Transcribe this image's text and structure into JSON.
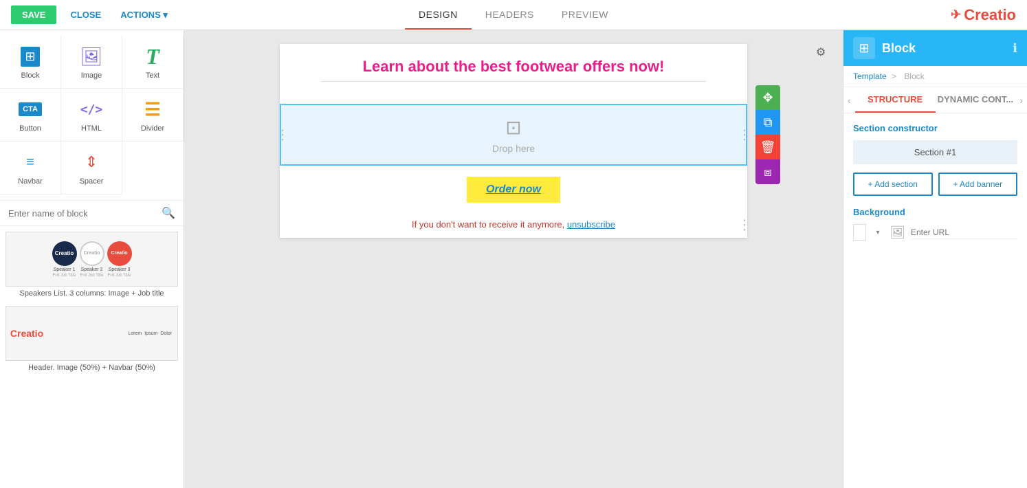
{
  "topbar": {
    "save_label": "SAVE",
    "close_label": "CLOSE",
    "actions_label": "ACTIONS",
    "tabs": [
      {
        "id": "design",
        "label": "DESIGN",
        "active": true
      },
      {
        "id": "headers",
        "label": "HEADERS",
        "active": false
      },
      {
        "id": "preview",
        "label": "PREVIEW",
        "active": false
      }
    ],
    "logo_text": "Creatio"
  },
  "left_panel": {
    "blocks": [
      {
        "id": "block",
        "label": "Block",
        "icon": "block"
      },
      {
        "id": "image",
        "label": "Image",
        "icon": "image"
      },
      {
        "id": "text",
        "label": "Text",
        "icon": "text"
      },
      {
        "id": "button",
        "label": "Button",
        "icon": "button"
      },
      {
        "id": "html",
        "label": "HTML",
        "icon": "html"
      },
      {
        "id": "divider",
        "label": "Divider",
        "icon": "divider"
      },
      {
        "id": "navbar",
        "label": "Navbar",
        "icon": "navbar"
      },
      {
        "id": "spacer",
        "label": "Spacer",
        "icon": "spacer"
      }
    ],
    "search_placeholder": "Enter name of block",
    "templates": [
      {
        "id": "speakers",
        "label": "Speakers List. 3 columns: Image + Job title",
        "type": "speakers"
      },
      {
        "id": "header-navbar",
        "label": "Header. Image (50%) + Navbar (50%)",
        "type": "header-navbar"
      }
    ]
  },
  "canvas": {
    "email_headline": "Learn about the best footwear offers now!",
    "drop_zone_text": "Drop here",
    "order_now_label": "Order now",
    "footer_text_before": "If you don't want to receive it anymore,",
    "footer_link_text": "unsubscribe"
  },
  "right_panel": {
    "title": "Block",
    "breadcrumb_template": "Template",
    "breadcrumb_separator": ">",
    "breadcrumb_current": "Block",
    "tabs": [
      {
        "id": "structure",
        "label": "STRUCTURE",
        "active": true
      },
      {
        "id": "dynamic",
        "label": "DYNAMIC CONT...",
        "active": false
      }
    ],
    "section_constructor_label": "Section constructor",
    "section_item_label": "Section #1",
    "add_section_label": "+ Add section",
    "add_banner_label": "+ Add banner",
    "background_label": "Background",
    "background_url_placeholder": "Enter URL"
  },
  "section_actions": {
    "move": "⊕",
    "copy": "⧉",
    "delete": "🗑",
    "duplicate": "⧈"
  }
}
